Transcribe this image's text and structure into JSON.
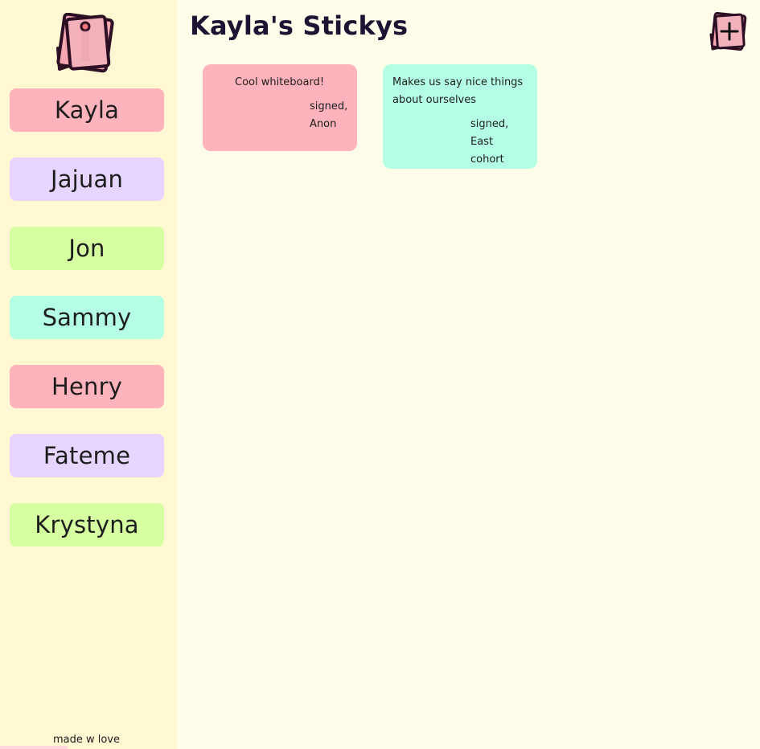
{
  "app": {
    "title": "Kayla's Stickys"
  },
  "sidebar": {
    "items": [
      {
        "label": "Kayla"
      },
      {
        "label": "Jajuan"
      },
      {
        "label": "Jon"
      },
      {
        "label": "Sammy"
      },
      {
        "label": "Henry"
      },
      {
        "label": "Fateme"
      },
      {
        "label": "Krystyna"
      }
    ],
    "footer": "made w love"
  },
  "notes": [
    {
      "text": "Cool whiteboard!",
      "signed": "signed,",
      "author": "Anon",
      "color": "#ffb3bd"
    },
    {
      "text": "Makes us say nice things about ourselves",
      "signed": "signed,",
      "author": "East cohort",
      "color": "#b4ffe4"
    }
  ],
  "icons": {
    "logo": "sticky-note-logo-icon",
    "add": "add-note-icon"
  },
  "colors": {
    "page_background": "#fffde9",
    "sidebar_background": "#fff8d3",
    "pink": "#ffb3bd",
    "lavender": "#e6d6ff",
    "lime": "#d5ffa0",
    "mint": "#b4ffe4"
  }
}
